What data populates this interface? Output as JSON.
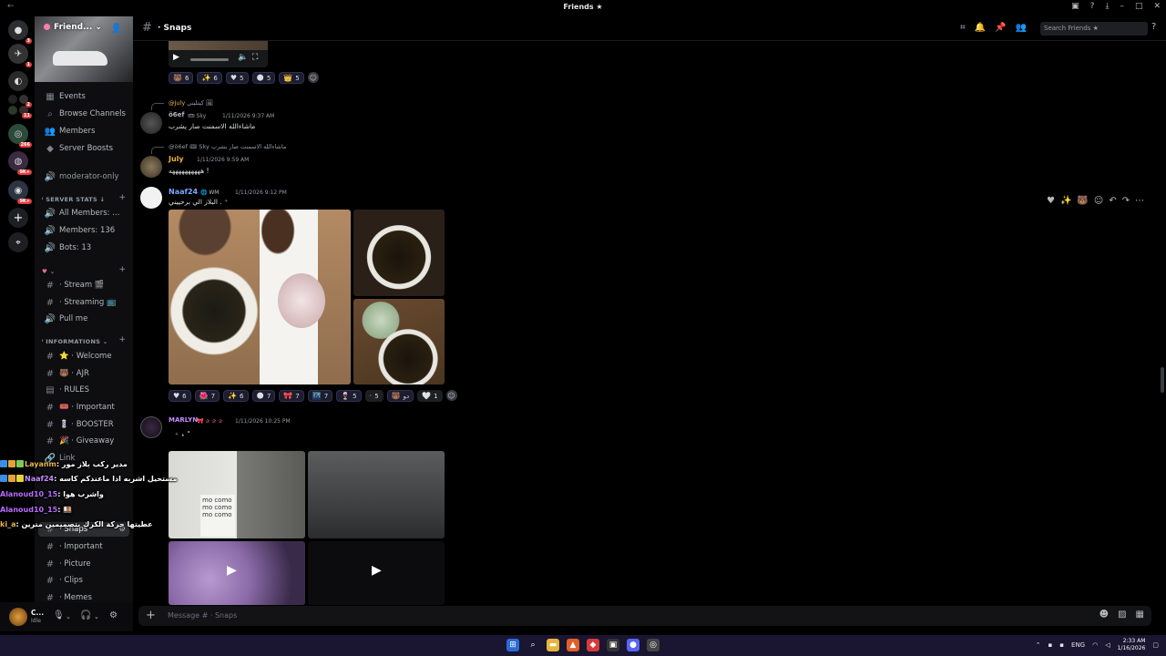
{
  "titlebar": {
    "title": "Friends ★",
    "back": "←",
    "minimize": "–",
    "maximize": "□",
    "close": "✕"
  },
  "guilds": {
    "badges": [
      "3",
      "1",
      "2",
      "11",
      "266",
      "9K+",
      "9K+"
    ]
  },
  "server": {
    "name": "Friend...",
    "chevron": "⌄"
  },
  "sidebar": {
    "top": [
      {
        "icon": "▦",
        "label": "Events"
      },
      {
        "icon": "⌕",
        "label": "Browse Channels"
      },
      {
        "icon": "👥",
        "label": "Members"
      },
      {
        "icon": "◆",
        "label": "Server Boosts"
      }
    ],
    "moderator": {
      "icon": "🔊",
      "label": "moderator-only"
    },
    "stats_category": "ⁱ SERVER STATS ↓",
    "stats": [
      {
        "icon": "🔊",
        "label": "All Members: ..."
      },
      {
        "icon": "🔊",
        "label": "Members: 136"
      },
      {
        "icon": "🔊",
        "label": "Bots: 13"
      }
    ],
    "cat2": "♥ ⌄",
    "voice": [
      {
        "icon": "#",
        "label": "· Stream 🎬"
      },
      {
        "icon": "#",
        "label": "· Streaming 📺"
      },
      {
        "icon": "🔊",
        "label": "Pull me"
      }
    ],
    "info_category": "ⁱ INFORMATIONS ⌄",
    "info": [
      {
        "icon": "#",
        "label": "⭐ · Welcome"
      },
      {
        "icon": "#",
        "label": "🐻 · AJR"
      },
      {
        "icon": "▤",
        "label": "· RULES"
      },
      {
        "icon": "#",
        "label": "🎟️ · Important"
      },
      {
        "icon": "#",
        "label": "💈 · BOOSTER"
      },
      {
        "icon": "#",
        "label": "🎉 · Giveaway"
      },
      {
        "icon": "🔗",
        "label": "Link"
      }
    ],
    "selected": {
      "icon": "#",
      "label": "· Snaps"
    },
    "after": [
      {
        "icon": "#",
        "label": "· Important"
      },
      {
        "icon": "#",
        "label": "· Picture"
      },
      {
        "icon": "#",
        "label": "· Clips"
      },
      {
        "icon": "#",
        "label": "· Memes"
      }
    ]
  },
  "user": {
    "name": "C...",
    "status": "Idle"
  },
  "header": {
    "hash": "#",
    "channel": "· Snaps",
    "search_placeholder": "Search Friends ★"
  },
  "messages": {
    "r1": [
      {
        "e": "🐻",
        "n": "6"
      },
      {
        "e": "✨",
        "n": "6"
      },
      {
        "e": "♥",
        "n": "5"
      },
      {
        "e": "🌑",
        "n": "5"
      },
      {
        "e": "👑",
        "n": "5"
      }
    ],
    "m1_reply_user": "@July",
    "m1_reply_text": "كيتليني 🖼",
    "m1_user": "ö6ef",
    "m1_tag": "🎟 Sky",
    "m1_time": "1/11/2026 9:37 AM",
    "m1_text": "ماشاءالله الاسمنت صار يشرب",
    "m2_reply_user": "@ö6ef",
    "m2_reply_tag": "🎟 Sky",
    "m2_reply_text": "ماشاءالله الاسمنت صار يشرب",
    "m2_user": "July",
    "m2_time": "1/11/2026 9:59 AM",
    "m2_text": "ههههههههههه !",
    "m3_user": "Naaf24",
    "m3_tag": "🌐 WM",
    "m3_time": "1/11/2026 9:12 PM",
    "m3_text": "البلاز الي برحييني . ⁺",
    "r2": [
      {
        "e": "♥",
        "n": "6"
      },
      {
        "e": "🌺",
        "n": "7"
      },
      {
        "e": "✨",
        "n": "6"
      },
      {
        "e": "🌑",
        "n": "7"
      },
      {
        "e": "🎀",
        "n": "7"
      },
      {
        "e": "🌃",
        "n": "7"
      },
      {
        "e": "🍷",
        "n": "5"
      },
      {
        "e": "·",
        "n": "5"
      },
      {
        "e": "🐻",
        "n": "دو"
      },
      {
        "e": "🤍",
        "n": "1"
      }
    ],
    "m4_user": "MARLYN",
    "m4_tag": "🎀 ✰ ✰ ✰",
    "m4_time": "1/11/2026 10:25 PM",
    "m4_text": "⁺ ⋆ ˚"
  },
  "composer": {
    "placeholder": "Message # · Snaps"
  },
  "overlay": [
    {
      "name": "Layanm",
      "text": ": مدير ركب بلاز مور",
      "color": "#e8b64a"
    },
    {
      "name": "Naaf24",
      "text": ": مستحيل اشربه اذا ماعندكم كاسه",
      "color": "#c58bff"
    },
    {
      "name": "Alanoud10_15",
      "text": ": واشرب هوا",
      "color": "#b86cff"
    },
    {
      "name": "Alanoud10_15",
      "text": ": 🍱",
      "color": "#b86cff"
    },
    {
      "name": "ki_a",
      "text": ": عطيتها حركة الكرك بتصميمين مترين",
      "color": "#e8b64a"
    }
  ],
  "taskbar": {
    "time": "2:33 AM",
    "date": "1/16/2026",
    "lang": "ENG"
  }
}
